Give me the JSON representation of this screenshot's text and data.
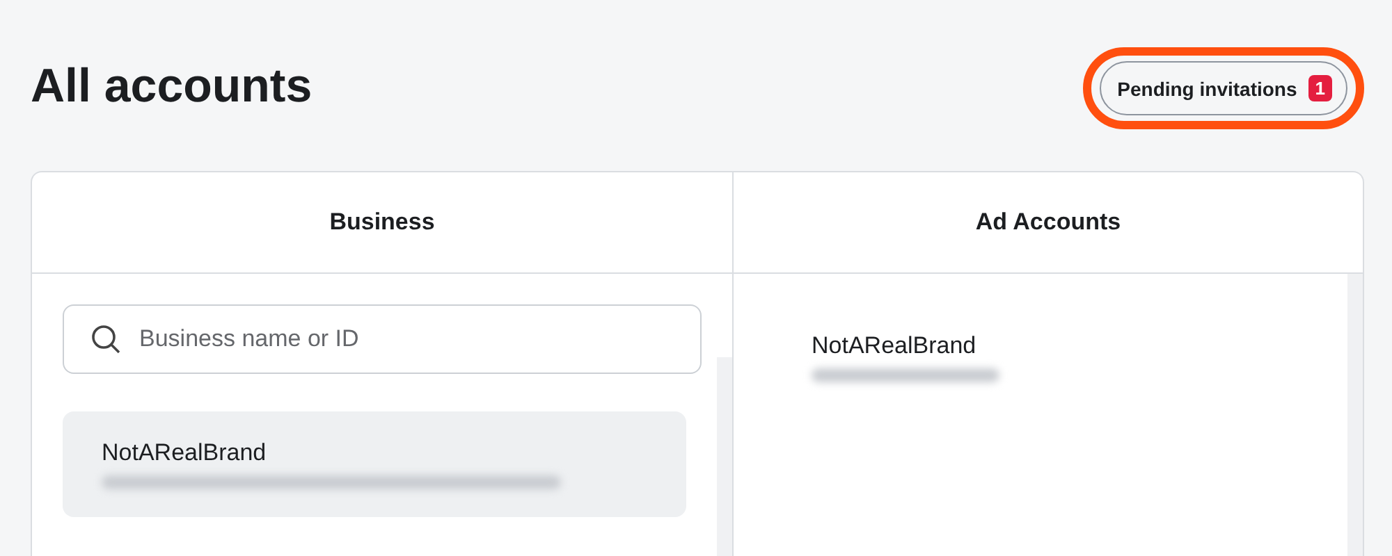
{
  "page": {
    "title": "All accounts"
  },
  "pending_button": {
    "label": "Pending invitations",
    "count": "1",
    "highlighted": true
  },
  "columns": [
    {
      "heading": "Business",
      "search": {
        "placeholder": "Business name or ID"
      },
      "items": [
        {
          "name": "NotARealBrand",
          "redacted": true,
          "selected": true
        }
      ]
    },
    {
      "heading": "Ad Accounts",
      "items": [
        {
          "name": "NotARealBrand",
          "redacted": true,
          "selected": false
        }
      ]
    }
  ]
}
